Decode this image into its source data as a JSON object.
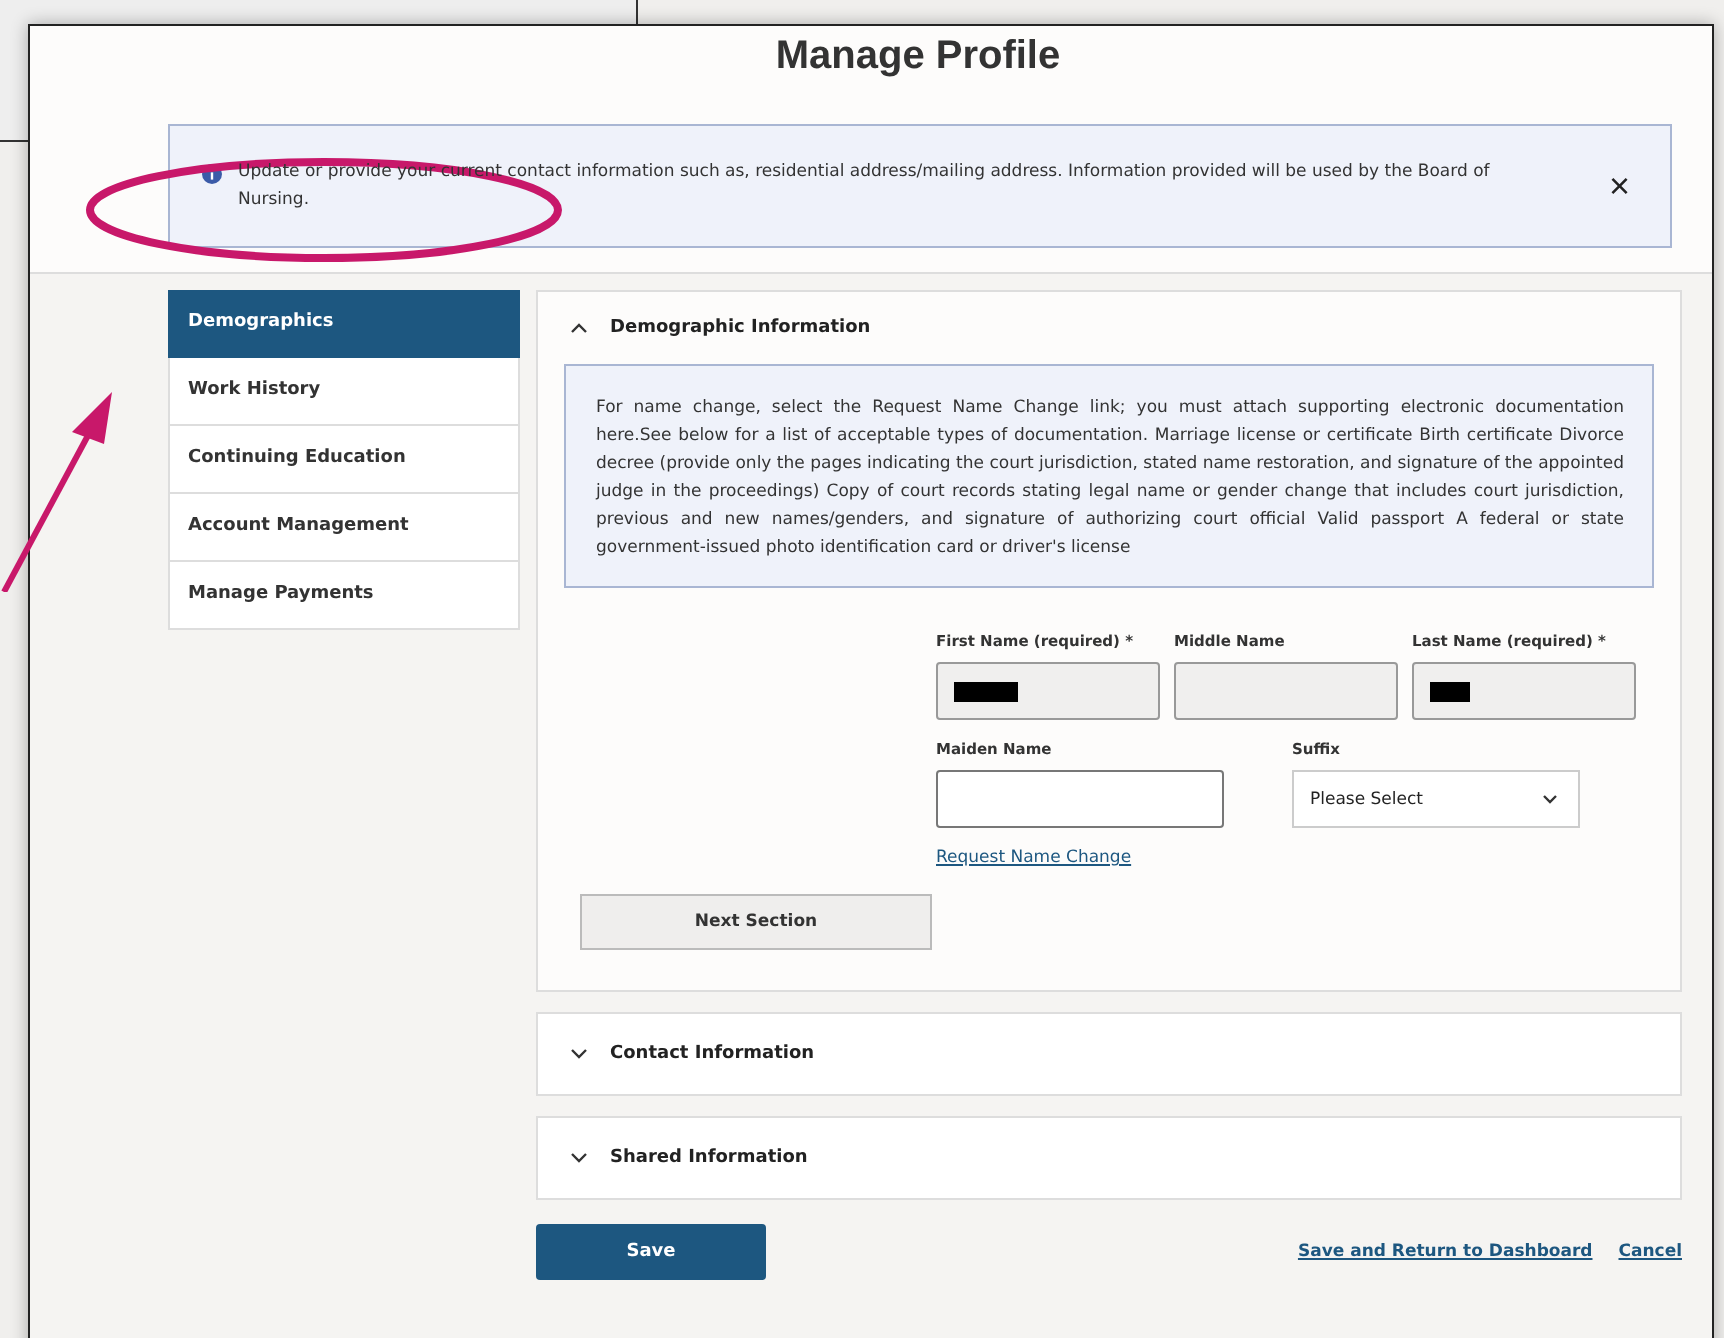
{
  "title": "Manage Profile",
  "alert": {
    "text": "Update or provide your current contact information such as, residential address/mailing address. Information provided will be used by the Board of Nursing.",
    "close": "×"
  },
  "sidebar": {
    "items": [
      {
        "label": "Demographics",
        "selected": true
      },
      {
        "label": "Work History",
        "selected": false
      },
      {
        "label": "Continuing Education",
        "selected": false
      },
      {
        "label": "Account Management",
        "selected": false
      },
      {
        "label": "Manage Payments",
        "selected": false
      }
    ]
  },
  "sections": [
    {
      "title": "Demographic Information",
      "expanded": true
    },
    {
      "title": "Contact Information",
      "expanded": false
    },
    {
      "title": "Shared Information",
      "expanded": false
    }
  ],
  "demographics": {
    "notice": "For name change, select the Request Name Change link; you must attach supporting electronic documentation here.See below for a list of acceptable types of documentation. Marriage license or certificate Birth certificate Divorce decree (provide only the pages indicating the court jurisdiction, stated name restoration, and signature of the appointed judge in the proceedings) Copy of court records stating legal name or gender change that includes court jurisdiction, previous and new names/genders, and signature of authorizing court official Valid passport A federal or state government-issued photo identification card or driver's license",
    "name_fields": [
      {
        "label": "First Name (required) *",
        "redacted": true,
        "readonly": true
      },
      {
        "label": "Middle Name",
        "redacted": false,
        "readonly": true
      },
      {
        "label": "Last Name (required) *",
        "redacted": true,
        "readonly": true
      }
    ],
    "maiden_name": {
      "label": "Maiden Name"
    },
    "suffix": {
      "label": "Suffix",
      "value": "Please Select"
    },
    "link": "Request Name Change",
    "next_button": "Next Section"
  },
  "actions": {
    "save": "Save",
    "links": [
      "Save and Return to Dashboard",
      "Cancel"
    ]
  }
}
